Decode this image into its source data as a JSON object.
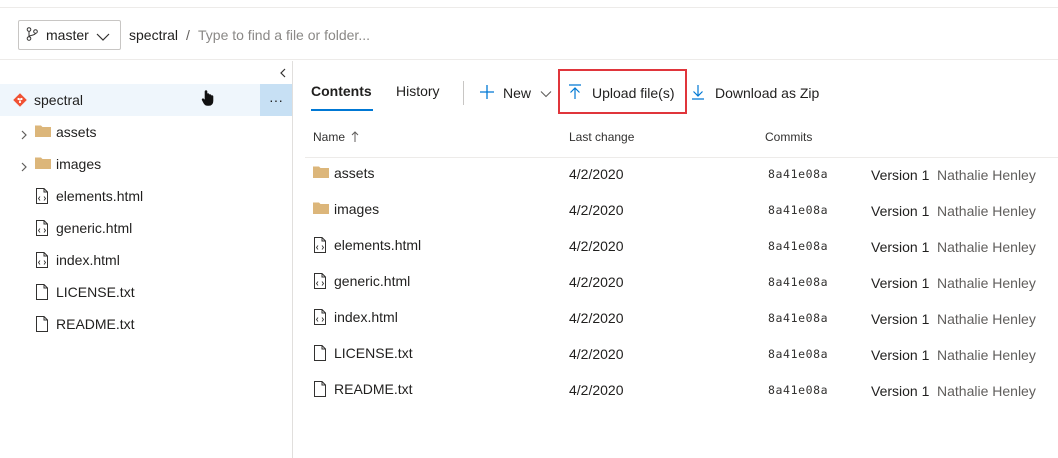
{
  "breadcrumb": {
    "branch": "master",
    "repo": "spectral",
    "separator": "/",
    "search_placeholder": "Type to find a file or folder..."
  },
  "tree": {
    "root": "spectral",
    "more_label": "···",
    "items": [
      {
        "label": "assets",
        "type": "folder"
      },
      {
        "label": "images",
        "type": "folder"
      },
      {
        "label": "elements.html",
        "type": "code-file"
      },
      {
        "label": "generic.html",
        "type": "code-file"
      },
      {
        "label": "index.html",
        "type": "code-file"
      },
      {
        "label": "LICENSE.txt",
        "type": "file"
      },
      {
        "label": "README.txt",
        "type": "file"
      }
    ]
  },
  "tabs": [
    {
      "label": "Contents",
      "active": true
    },
    {
      "label": "History",
      "active": false
    }
  ],
  "commands": {
    "new_label": "New",
    "upload_label": "Upload file(s)",
    "zip_label": "Download as Zip"
  },
  "table": {
    "columns": {
      "name": "Name",
      "last_change": "Last change",
      "commits": "Commits"
    },
    "rows": [
      {
        "name": "assets",
        "type": "folder",
        "date": "4/2/2020",
        "hash": "8a41e08a",
        "message": "Version 1",
        "author": "Nathalie Henley"
      },
      {
        "name": "images",
        "type": "folder",
        "date": "4/2/2020",
        "hash": "8a41e08a",
        "message": "Version 1",
        "author": "Nathalie Henley"
      },
      {
        "name": "elements.html",
        "type": "code-file",
        "date": "4/2/2020",
        "hash": "8a41e08a",
        "message": "Version 1",
        "author": "Nathalie Henley"
      },
      {
        "name": "generic.html",
        "type": "code-file",
        "date": "4/2/2020",
        "hash": "8a41e08a",
        "message": "Version 1",
        "author": "Nathalie Henley"
      },
      {
        "name": "index.html",
        "type": "code-file",
        "date": "4/2/2020",
        "hash": "8a41e08a",
        "message": "Version 1",
        "author": "Nathalie Henley"
      },
      {
        "name": "LICENSE.txt",
        "type": "file",
        "date": "4/2/2020",
        "hash": "8a41e08a",
        "message": "Version 1",
        "author": "Nathalie Henley"
      },
      {
        "name": "README.txt",
        "type": "file",
        "date": "4/2/2020",
        "hash": "8a41e08a",
        "message": "Version 1",
        "author": "Nathalie Henley"
      }
    ]
  },
  "colors": {
    "accent": "#0078d4",
    "folder": "#dcb67a",
    "git": "#f05133",
    "highlight_box": "#e0353b",
    "selected_row": "#eff6fc"
  }
}
